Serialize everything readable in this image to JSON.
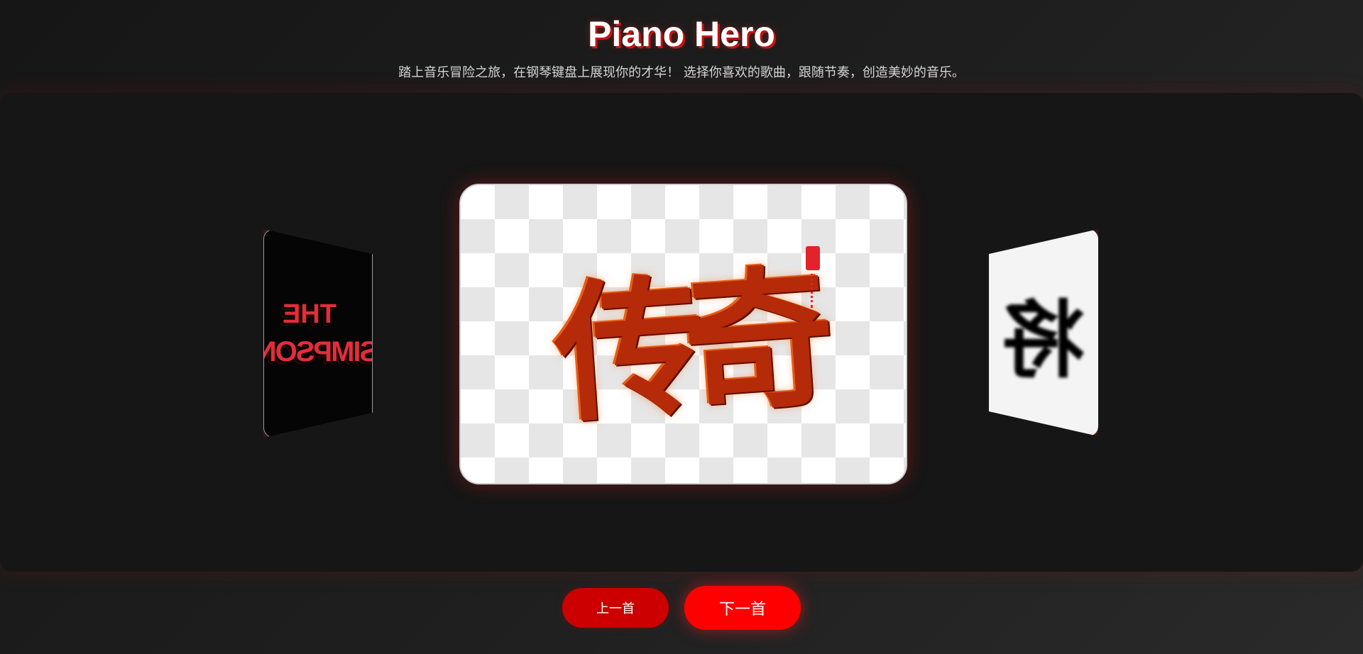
{
  "header": {
    "title": "Piano Hero",
    "subtitle": "踏上音乐冒险之旅，在钢琴键盘上展现你的才华！ 选择你喜欢的歌曲，跟随节奏，创造美妙的音乐。"
  },
  "carousel": {
    "left_cover": {
      "line1": "THE",
      "line2": "SIMPSON"
    },
    "center_cover": {
      "text": "传奇"
    },
    "right_cover": {
      "text": "将"
    }
  },
  "controls": {
    "prev_label": "上一首",
    "next_label": "下一首"
  },
  "colors": {
    "accent_red": "#ff0000",
    "button_dark_red": "#cc0000",
    "background": "#161616"
  }
}
